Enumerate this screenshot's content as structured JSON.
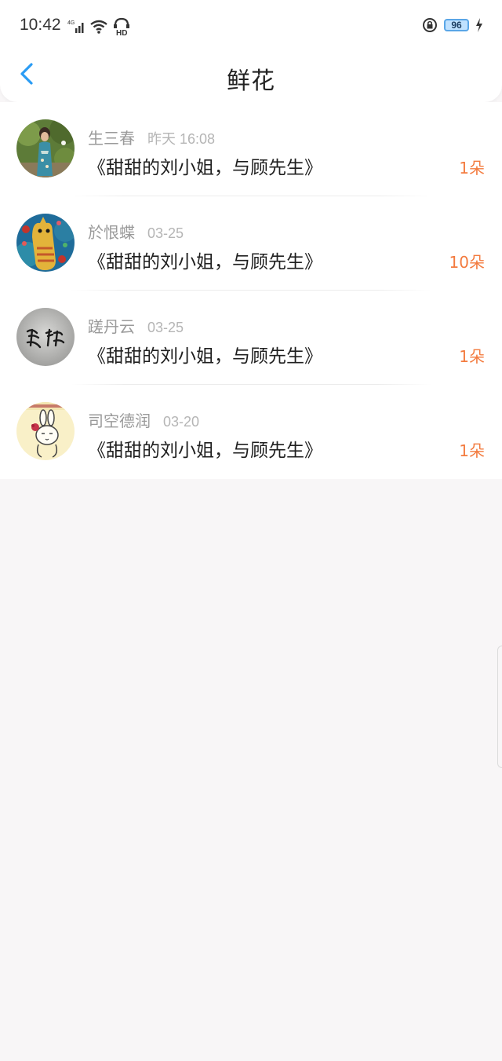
{
  "status_bar": {
    "time": "10:42",
    "network": "4G",
    "hd": "HD",
    "battery": "96"
  },
  "nav": {
    "title": "鲜花"
  },
  "rows": [
    {
      "name": "生三春",
      "time": "昨天 16:08",
      "book": "《甜甜的刘小姐，与顾先生》",
      "count": "1朵",
      "avatar": "photo-portrait-avatar"
    },
    {
      "name": "於恨蝶",
      "time": "03-25",
      "book": "《甜甜的刘小姐，与顾先生》",
      "count": "10朵",
      "avatar": "cat-painting-avatar"
    },
    {
      "name": "蹉丹云",
      "time": "03-25",
      "book": "《甜甜的刘小姐，与顾先生》",
      "count": "1朵",
      "avatar": "calligraphy-avatar"
    },
    {
      "name": "司空德润",
      "time": "03-20",
      "book": "《甜甜的刘小姐，与顾先生》",
      "count": "1朵",
      "avatar": "cartoon-rabbit-avatar"
    }
  ],
  "colors": {
    "accent_blue": "#2a9cf4",
    "count_orange": "#f37b3f",
    "background": "#f8f6f7"
  }
}
